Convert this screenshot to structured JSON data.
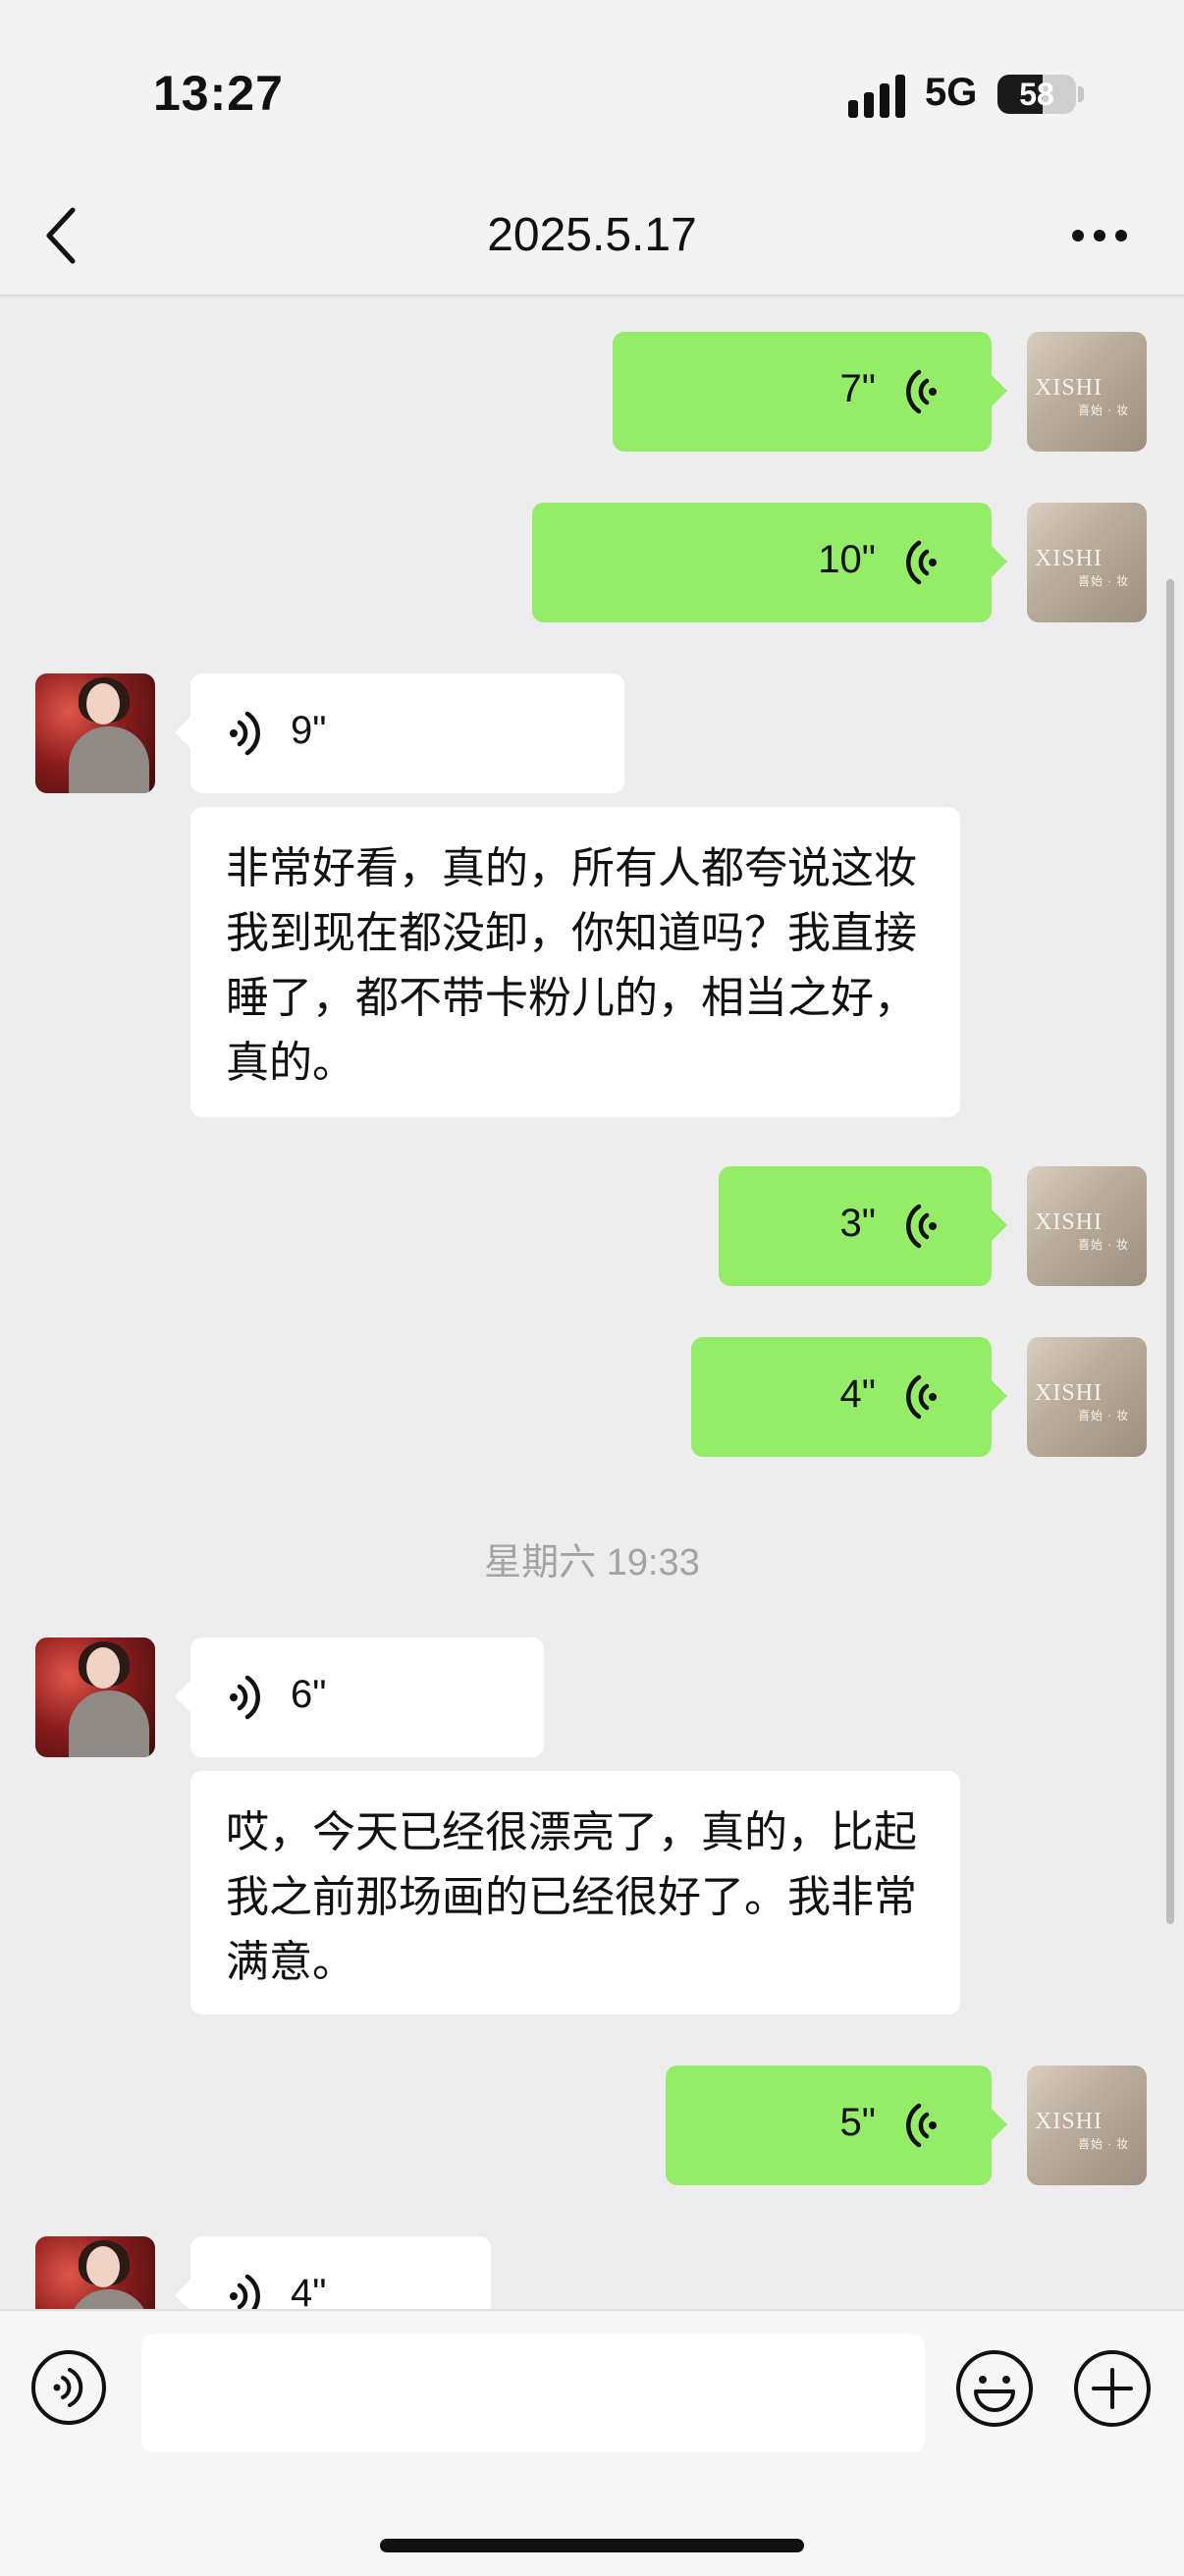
{
  "status_bar": {
    "time": "13:27",
    "network": "5G",
    "battery": "58"
  },
  "nav": {
    "title": "2025.5.17",
    "back_icon": "chevron-left-icon",
    "more_icon": "more-dots-icon"
  },
  "avatars": {
    "me_logo": "XISHI",
    "me_logo_sub": "喜始 · 妆"
  },
  "messages": [
    {
      "side": "me",
      "type": "voice",
      "duration": "7\""
    },
    {
      "side": "me",
      "type": "voice",
      "duration": "10\""
    },
    {
      "side": "other",
      "type": "voice",
      "duration": "9\""
    },
    {
      "side": "other",
      "type": "text",
      "text": "非常好看，真的，所有人都夸说这妆我到现在都没卸，你知道吗？我直接睡了，都不带卡粉儿的，相当之好，真的。"
    },
    {
      "side": "me",
      "type": "voice",
      "duration": "3\""
    },
    {
      "side": "me",
      "type": "voice",
      "duration": "4\""
    },
    {
      "type": "timestamp",
      "text": "星期六 19:33"
    },
    {
      "side": "other",
      "type": "voice",
      "duration": "6\""
    },
    {
      "side": "other",
      "type": "text",
      "text": "哎，今天已经很漂亮了，真的，比起我之前那场画的已经很好了。我非常满意。"
    },
    {
      "side": "me",
      "type": "voice",
      "duration": "5\""
    },
    {
      "side": "other",
      "type": "voice",
      "duration": "4\""
    }
  ],
  "input_bar": {
    "voice_icon": "voice-mode-icon",
    "emoji_icon": "emoji-icon",
    "plus_icon": "plus-icon",
    "text": ""
  },
  "colors": {
    "my_bubble": "#95ec69",
    "other_bubble": "#ffffff",
    "background": "#ededed"
  }
}
